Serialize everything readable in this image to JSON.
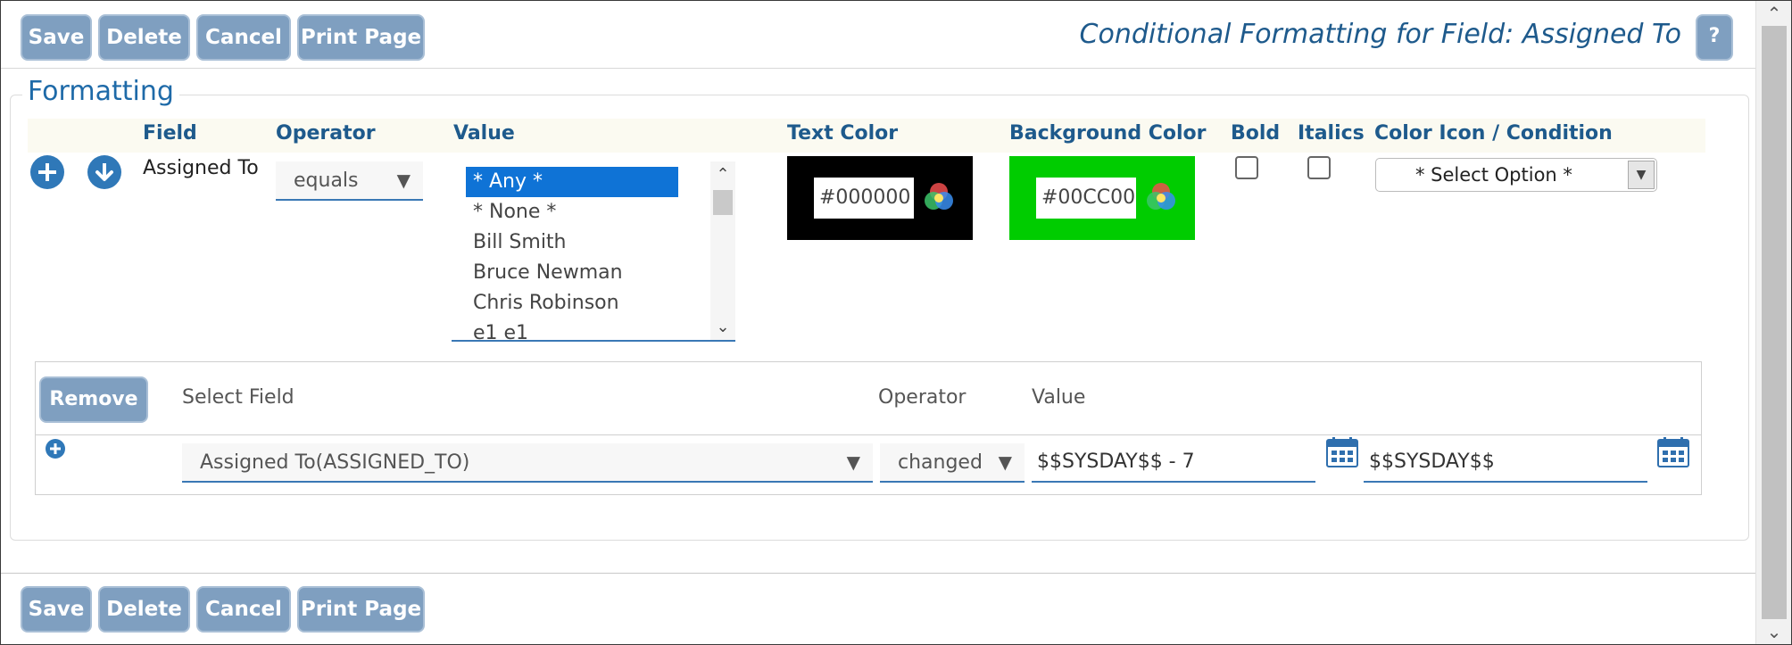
{
  "toolbar": {
    "save_label": "Save",
    "delete_label": "Delete",
    "cancel_label": "Cancel",
    "print_label": "Print Page"
  },
  "header": {
    "title": "Conditional Formatting for Field: Assigned To",
    "help_label": "?"
  },
  "formatting": {
    "legend": "Formatting",
    "columns": {
      "field": "Field",
      "operator": "Operator",
      "value": "Value",
      "text_color": "Text Color",
      "background_color": "Background Color",
      "bold": "Bold",
      "italics": "Italics",
      "color_icon": "Color Icon / Condition"
    },
    "row": {
      "field": "Assigned To",
      "operator": "equals",
      "value_options": [
        "* Any *",
        "* None *",
        "Bill Smith",
        "Bruce Newman",
        "Chris Robinson",
        "e1 e1"
      ],
      "selected_value": "* Any *",
      "text_color": "#000000",
      "background_color": "#00CC00",
      "bold": false,
      "italics": false,
      "color_icon": "* Select Option *"
    }
  },
  "condition": {
    "remove_label": "Remove",
    "headers": {
      "select_field": "Select Field",
      "operator": "Operator",
      "value": "Value"
    },
    "row": {
      "field": "Assigned To(ASSIGNED_TO)",
      "operator": "changed",
      "value_from": "$$SYSDAY$$ - 7",
      "value_to": "$$SYSDAY$$"
    }
  },
  "colors": {
    "accent": "#1e5a8c",
    "button_bg": "#7f9fc0",
    "selection": "#0f73d6",
    "text_color_swatch": "#000000",
    "background_color_swatch": "#00CC00"
  },
  "icons": [
    "add-circle-icon",
    "move-down-icon",
    "color-wheel-icon",
    "calendar-icon",
    "chevron-down-icon"
  ]
}
